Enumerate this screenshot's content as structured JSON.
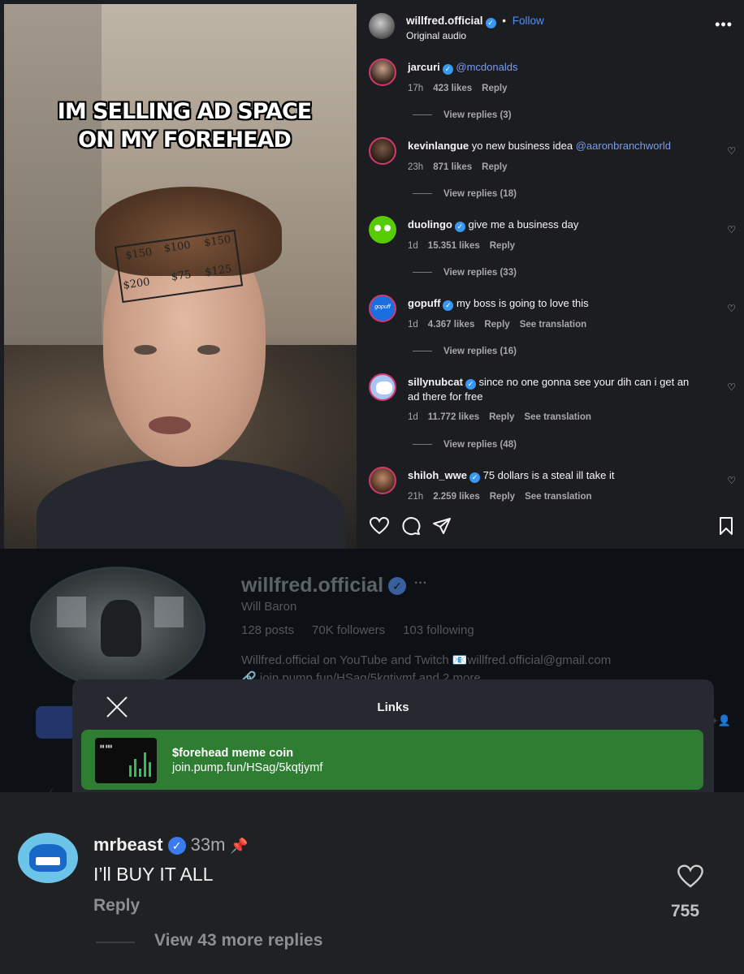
{
  "video": {
    "caption_line1": "IM SELLING AD SPACE",
    "caption_line2": "ON MY FOREHEAD",
    "forehead_prices": [
      "$150",
      "$100",
      "$150",
      "$200",
      "$75",
      "$125"
    ]
  },
  "post_header": {
    "username": "willfred.official",
    "separator": "•",
    "follow": "Follow",
    "audio": "Original audio",
    "more": "•••"
  },
  "comments": [
    {
      "user": "jarcuri",
      "verified": true,
      "mention": "@mcdonalds",
      "text": "",
      "time": "17h",
      "likes": "423 likes",
      "reply": "Reply",
      "translation": "",
      "view_replies": "View replies (3)"
    },
    {
      "user": "kevinlangue",
      "verified": false,
      "mention": "@aaronbranchworld",
      "text": "yo new business idea",
      "time": "23h",
      "likes": "871 likes",
      "reply": "Reply",
      "translation": "",
      "view_replies": "View replies (18)"
    },
    {
      "user": "duolingo",
      "verified": true,
      "mention": "",
      "text": "give me a business day",
      "time": "1d",
      "likes": "15.351 likes",
      "reply": "Reply",
      "translation": "",
      "view_replies": "View replies (33)"
    },
    {
      "user": "gopuff",
      "verified": true,
      "mention": "",
      "text": "my boss is going to love this",
      "time": "1d",
      "likes": "4.367 likes",
      "reply": "Reply",
      "translation": "See translation",
      "view_replies": "View replies (16)"
    },
    {
      "user": "sillynubcat",
      "verified": true,
      "mention": "",
      "text": "since no one gonna see your dih can i get an ad there for free",
      "time": "1d",
      "likes": "11.772 likes",
      "reply": "Reply",
      "translation": "See translation",
      "view_replies": "View replies (48)"
    },
    {
      "user": "shiloh_wwe",
      "verified": true,
      "mention": "",
      "text": "75 dollars is a steal ill take it",
      "time": "21h",
      "likes": "2.259 likes",
      "reply": "Reply",
      "translation": "See translation",
      "view_replies": ""
    }
  ],
  "profile": {
    "username": "willfred.official",
    "more": "···",
    "full_name": "Will Baron",
    "posts": "128 posts",
    "followers": "70K followers",
    "following": "103 following",
    "bio": "Willfred.official on YouTube and Twitch 📧willfred.official@gmail.com",
    "link_line": "join.pump.fun/HSag/5kqtjymf and 2 more"
  },
  "links_modal": {
    "title": "Links",
    "card_title": "$forehead meme coin",
    "card_url": "join.pump.fun/HSag/5kqtjymf"
  },
  "mrbeast_comment": {
    "user": "mrbeast",
    "time": "33m",
    "text": "I’ll BUY IT ALL",
    "reply": "Reply",
    "likes": "755",
    "view_more": "View 43 more replies"
  },
  "colors": {
    "verified_blue": "#3897f0",
    "follow_blue": "#4f8ff7",
    "mention_blue": "#7a9bf0",
    "link_card_green": "#2f7d32"
  },
  "icons": {
    "heart": "heart-icon",
    "comment": "comment-icon",
    "share": "share-icon",
    "bookmark": "bookmark-icon",
    "close": "close-icon",
    "pin": "pin-icon"
  }
}
